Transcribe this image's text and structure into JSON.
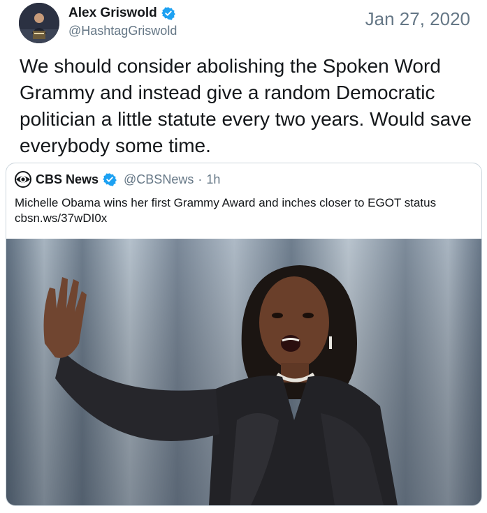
{
  "author": {
    "name": "Alex Griswold",
    "handle": "@HashtagGriswold",
    "verified": true
  },
  "date": "Jan 27, 2020",
  "tweet_text": "We should consider abolishing the Spoken Word Grammy and instead give a random Democratic politician a little statute every two years. Would save everybody some time.",
  "quoted_tweet": {
    "name": "CBS News",
    "handle": "@CBSNews",
    "separator": "·",
    "time": "1h",
    "verified": true,
    "text": "Michelle Obama wins her first Grammy Award and inches closer to EGOT status",
    "link": "cbsn.ws/37wDI0x"
  },
  "colors": {
    "text": "#14171a",
    "secondary": "#657786",
    "verified": "#1da1f2",
    "border": "#ccd6dd"
  },
  "icons": {
    "verified": "verified-badge-icon",
    "cbs_logo": "cbs-eye-logo-icon"
  }
}
